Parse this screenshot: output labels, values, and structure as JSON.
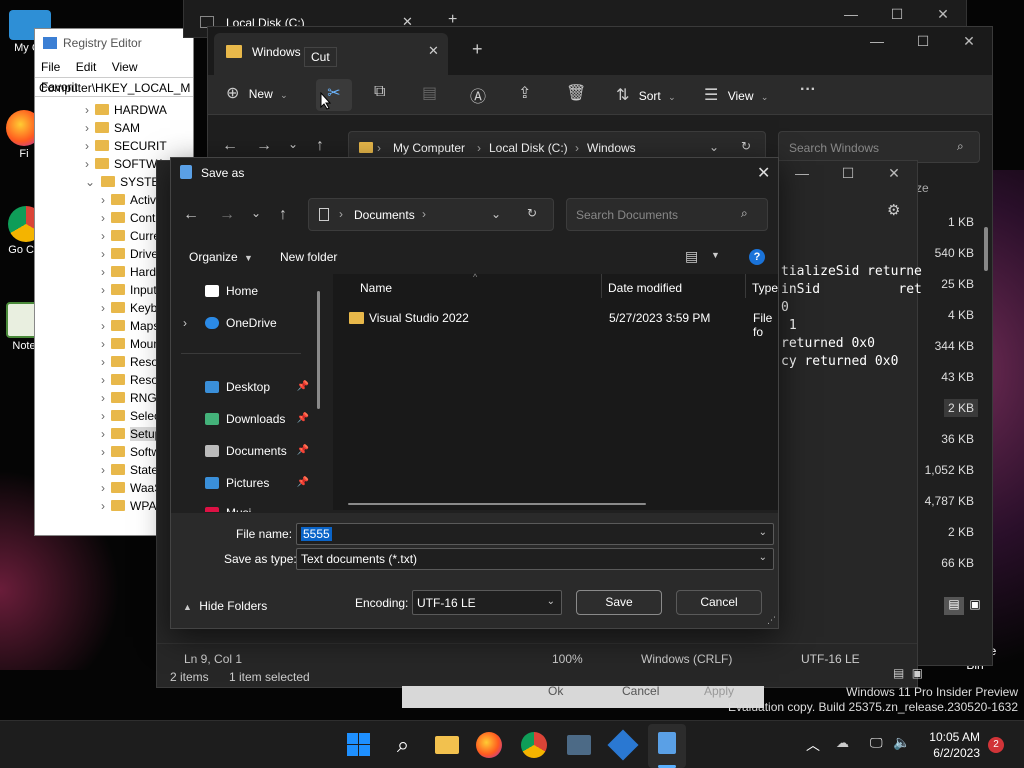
{
  "desktop": {
    "icons": [
      {
        "label": "My Co",
        "icon": "computer-icon"
      },
      {
        "label": "Fi",
        "icon": "firefox-icon"
      },
      {
        "label": "Go Chr",
        "icon": "chrome-icon"
      },
      {
        "label": "Note",
        "icon": "notepad-icon"
      }
    ],
    "recycle_bin": "Recycle Bin",
    "watermark_line1": "Windows 11 Pro Insider Preview",
    "watermark_line2": "Evaluation copy. Build 25375.zn_release.230520-1632"
  },
  "registry": {
    "title": "Registry Editor",
    "menu": [
      "File",
      "Edit",
      "View",
      "Favorit"
    ],
    "address": "Computer\\HKEY_LOCAL_M",
    "tree": [
      "HARDWA",
      "SAM",
      "SECURIT",
      "SOFTWA",
      "SYSTEM",
      "Activa",
      "Contr",
      "Curre",
      "Driver",
      "Hardw",
      "Input",
      "Keybo",
      "Maps",
      "Moun",
      "Resou",
      "Resou",
      "RNG",
      "Select",
      "Setup",
      "Softw",
      "State",
      "WaaS",
      "WPA"
    ]
  },
  "explorer_back": {
    "tab_title": "Local Disk (C:)"
  },
  "explorer": {
    "tab_title": "Windows",
    "tooltip": "Cut",
    "toolbar": {
      "new": "New",
      "sort": "Sort",
      "view": "View"
    },
    "breadcrumb": [
      "My Computer",
      "Local Disk (C:)",
      "Windows"
    ],
    "search_placeholder": "Search Windows",
    "size_header": "ze",
    "sizes": [
      "1 KB",
      "540 KB",
      "25 KB",
      "4 KB",
      "344 KB",
      "43 KB",
      "2 KB",
      "36 KB",
      "1,052 KB",
      "4,787 KB",
      "2 KB",
      "66 KB"
    ],
    "status_items": "2 items",
    "status_selected": "1 item selected"
  },
  "notepad": {
    "text_lines": [
      "tializeSid returne",
      "inSid          ret",
      "0",
      " 1",
      "returned 0x0",
      "cy returned 0x0"
    ],
    "status": {
      "position": "Ln 9, Col 1",
      "zoom": "100%",
      "line_ending": "Windows (CRLF)",
      "encoding": "UTF-16 LE"
    }
  },
  "save_dialog": {
    "title": "Save as",
    "location": "Documents",
    "search_placeholder": "Search Documents",
    "organize": "Organize",
    "new_folder": "New folder",
    "nav": [
      {
        "label": "Home",
        "icon": "home-icon"
      },
      {
        "label": "OneDrive",
        "icon": "onedrive-icon"
      },
      {
        "label": "Desktop",
        "icon": "desktop-icon"
      },
      {
        "label": "Downloads",
        "icon": "download-icon"
      },
      {
        "label": "Documents",
        "icon": "documents-icon"
      },
      {
        "label": "Pictures",
        "icon": "pictures-icon"
      },
      {
        "label": "Musi",
        "icon": "music-icon"
      }
    ],
    "columns": [
      "Name",
      "Date modified",
      "Type"
    ],
    "files": [
      {
        "name": "Visual Studio 2022",
        "date": "5/27/2023 3:59 PM",
        "type": "File fo"
      }
    ],
    "file_name_label": "File name:",
    "file_name_value": "5555",
    "save_type_label": "Save as type:",
    "save_type_value": "Text documents (*.txt)",
    "hide_folders": "Hide Folders",
    "encoding_label": "Encoding:",
    "encoding_value": "UTF-16 LE",
    "save": "Save",
    "cancel": "Cancel"
  },
  "behind_buttons": {
    "ok": "Ok",
    "cancel": "Cancel",
    "apply": "Apply"
  },
  "taskbar": {
    "time": "10:05 AM",
    "date": "6/2/2023",
    "notification_count": "2"
  },
  "colors": {
    "accent": "#0a64c8",
    "folder": "#e8b84a",
    "badge": "#d13438"
  }
}
